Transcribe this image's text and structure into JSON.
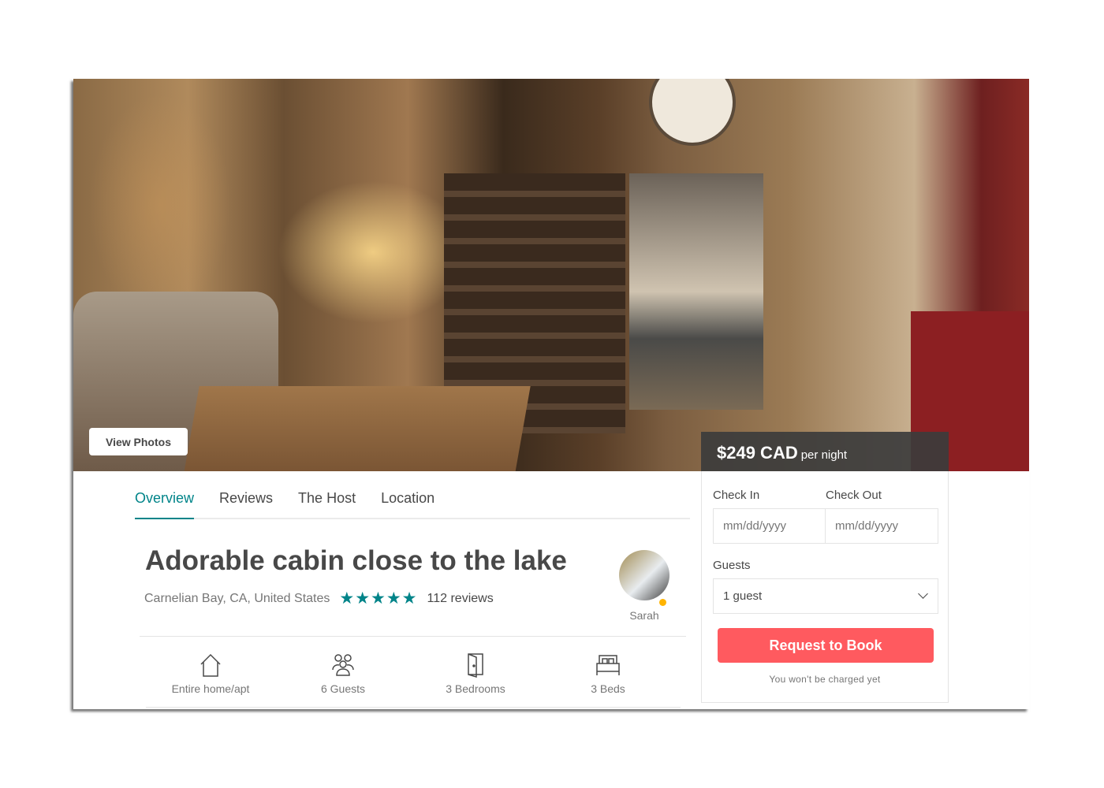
{
  "photo": {
    "view_photos_label": "View Photos"
  },
  "price": {
    "amount": "$249 CAD",
    "unit": "per night"
  },
  "booking": {
    "check_in_label": "Check In",
    "check_out_label": "Check Out",
    "check_in_placeholder": "mm/dd/yyyy",
    "check_out_placeholder": "mm/dd/yyyy",
    "guests_label": "Guests",
    "guests_value": "1 guest",
    "request_label": "Request to Book",
    "note": "You won't be charged yet",
    "accent": "#ff5a5f"
  },
  "tabs": [
    {
      "label": "Overview",
      "active": true
    },
    {
      "label": "Reviews"
    },
    {
      "label": "The Host"
    },
    {
      "label": "Location"
    }
  ],
  "listing": {
    "title": "Adorable cabin close to the lake",
    "location": "Carnelian Bay, CA, United States",
    "rating": 5,
    "stars": "★★★★★",
    "reviews": "112 reviews",
    "host": "Sarah",
    "accent": "#008489"
  },
  "amenities": [
    {
      "icon": "home-icon",
      "label": "Entire home/apt"
    },
    {
      "icon": "guests-icon",
      "label": "6 Guests"
    },
    {
      "icon": "door-icon",
      "label": "3 Bedrooms"
    },
    {
      "icon": "bed-icon",
      "label": "3 Beds"
    }
  ]
}
